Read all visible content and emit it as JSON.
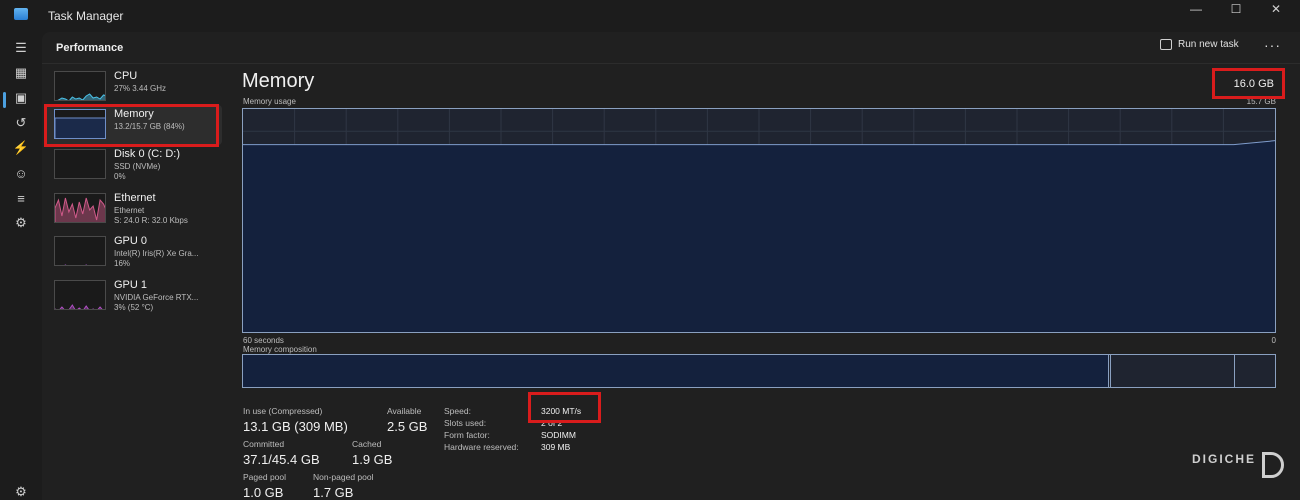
{
  "window": {
    "title": "Task Manager",
    "minimize": "—",
    "maximize": "☐",
    "close": "✕"
  },
  "header": {
    "page_title": "Performance",
    "run_task_label": "Run new task",
    "more": "···"
  },
  "sidebar": [
    {
      "name": "CPU",
      "sub1": "27%  3.44 GHz",
      "sub2": "",
      "sub3": "",
      "color": "#4cc2e8"
    },
    {
      "name": "Memory",
      "sub1": "13.2/15.7 GB (84%)",
      "sub2": "",
      "sub3": "",
      "color": "#6f8fc9"
    },
    {
      "name": "Disk 0 (C: D:)",
      "sub1": "SSD (NVMe)",
      "sub2": "0%",
      "sub3": "",
      "color": "#7ab648"
    },
    {
      "name": "Ethernet",
      "sub1": "Ethernet",
      "sub2": "S: 24.0  R: 32.0 Kbps",
      "sub3": "",
      "color": "#d05a8a"
    },
    {
      "name": "GPU 0",
      "sub1": "Intel(R) Iris(R) Xe Gra...",
      "sub2": "16%",
      "sub3": "",
      "color": "#a34fc9"
    },
    {
      "name": "GPU 1",
      "sub1": "NVIDIA GeForce RTX...",
      "sub2": "3%  (52 °C)",
      "sub3": "",
      "color": "#b04fc4"
    }
  ],
  "memory": {
    "title": "Memory",
    "total": "16.0 GB",
    "usage_label": "Memory usage",
    "usage_max": "15.7 GB",
    "time_left": "60 seconds",
    "time_right": "0",
    "composition_label": "Memory composition",
    "usage_fraction": 0.84,
    "composition_fractions": {
      "in_use": 0.838,
      "modified": 0.003,
      "standby": 0.12,
      "free": 0.039
    },
    "stats": {
      "in_use_label": "In use (Compressed)",
      "in_use_value": "13.1 GB (309 MB)",
      "available_label": "Available",
      "available_value": "2.5 GB",
      "committed_label": "Committed",
      "committed_value": "37.1/45.4 GB",
      "cached_label": "Cached",
      "cached_value": "1.9 GB",
      "paged_label": "Paged pool",
      "paged_value": "1.0 GB",
      "nonpaged_label": "Non-paged pool",
      "nonpaged_value": "1.7 GB"
    },
    "details": [
      {
        "label": "Speed:",
        "value": "3200 MT/s"
      },
      {
        "label": "Slots used:",
        "value": "2 of 2"
      },
      {
        "label": "Form factor:",
        "value": "SODIMM"
      },
      {
        "label": "Hardware reserved:",
        "value": "309 MB"
      }
    ]
  },
  "watermark": "DIGICHE",
  "colors": {
    "graph_fill": "#14213d",
    "graph_line": "#7f9ccc",
    "highlight": "#d91c1c",
    "accent": "#4ca0e0"
  }
}
